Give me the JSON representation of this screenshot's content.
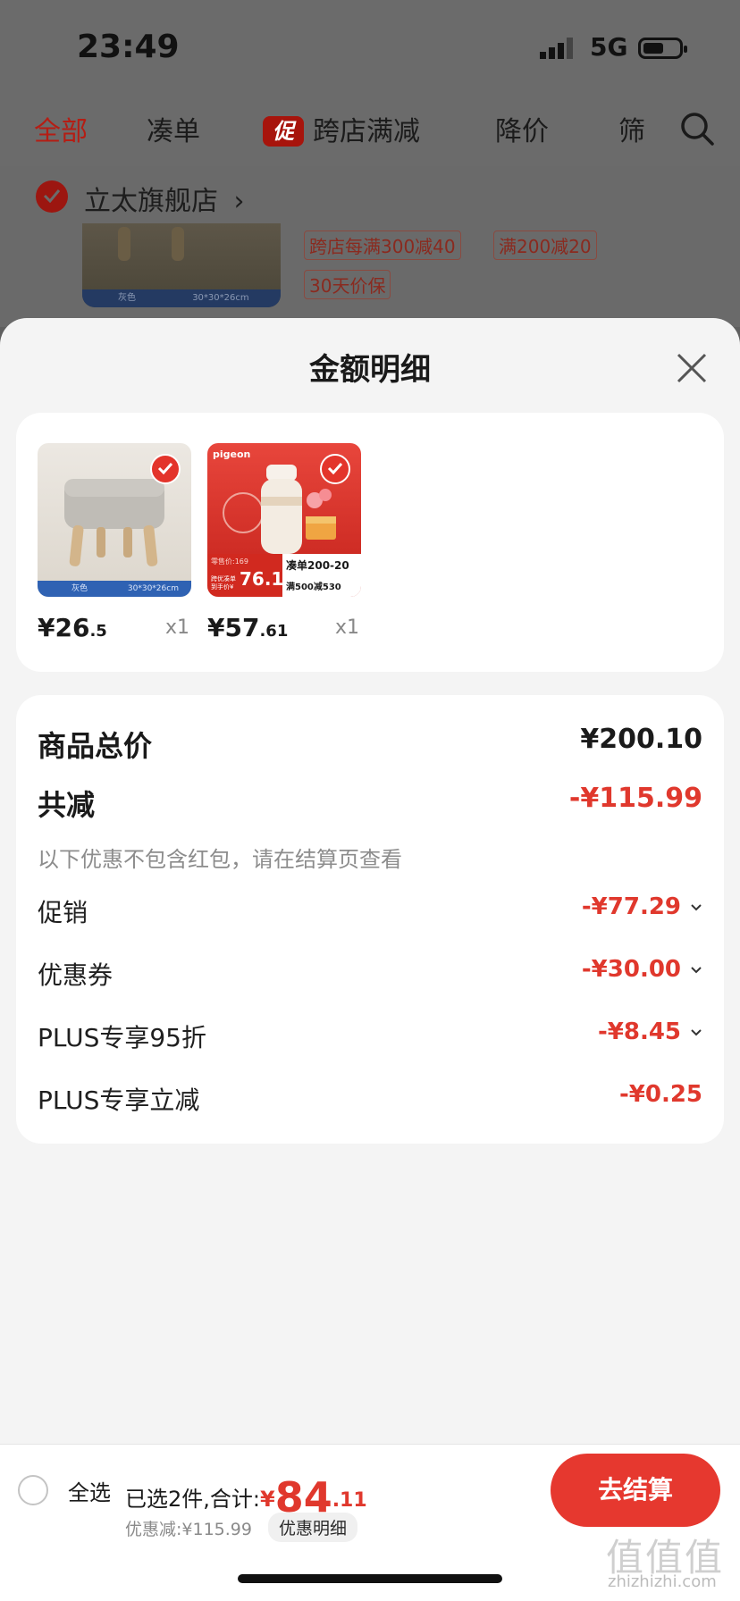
{
  "status_bar": {
    "time": "23:49",
    "network": "5G"
  },
  "tabs": [
    {
      "label": "全部",
      "active": true
    },
    {
      "label": "凑单"
    },
    {
      "label": "跨店满减",
      "badge": "促"
    },
    {
      "label": "降价"
    },
    {
      "label": "筛"
    }
  ],
  "store": {
    "name": "立太旗舰店",
    "chevron": "›"
  },
  "bg_product": {
    "thumb_strip_left": "灰色",
    "thumb_strip_right": "30*30*26cm",
    "tags": [
      "跨店每满300减40",
      "满200减20",
      "30天价保"
    ]
  },
  "sheet": {
    "title": "金额明细",
    "products": [
      {
        "price_int": "¥26",
        "price_dec": ".5",
        "qty": "x1",
        "strip_left": "灰色",
        "strip_right": "30*30*26cm"
      },
      {
        "price_int": "¥57",
        "price_dec": ".61",
        "qty": "x1",
        "img_brand": "pigeon",
        "img_retail": "零售价:169",
        "img_price": "76.1",
        "img_pre": "跨优凑单 到手价¥",
        "img_promo": "凑单200-20",
        "img_promo2": "满500减530"
      }
    ],
    "total_label": "商品总价",
    "total_value": "¥200.10",
    "discount_label": "共减",
    "discount_value": "-¥115.99",
    "discount_note": "以下优惠不包含红包，请在结算页查看",
    "items": [
      {
        "label": "促销",
        "value": "-¥77.29",
        "expand": true
      },
      {
        "label": "优惠券",
        "value": "-¥30.00",
        "expand": true
      },
      {
        "label": "PLUS专享95折",
        "value": "-¥8.45",
        "expand": true
      },
      {
        "label": "PLUS专享立减",
        "value": "-¥0.25",
        "expand": false
      }
    ]
  },
  "bottom": {
    "select_all": "全选",
    "summary_prefix": "已选2件,合计:",
    "currency": "¥",
    "total_int": "84",
    "total_dec": ".11",
    "saved": "优惠减:¥115.99",
    "detail_link": "优惠明细",
    "checkout": "去结算"
  },
  "watermark": {
    "main": "值值值",
    "sub": "zhizhizhi.com"
  },
  "colors": {
    "accent_red": "#e0382d",
    "checkout_red": "#e6382f",
    "dim_overlay": "#6b6b6b"
  }
}
